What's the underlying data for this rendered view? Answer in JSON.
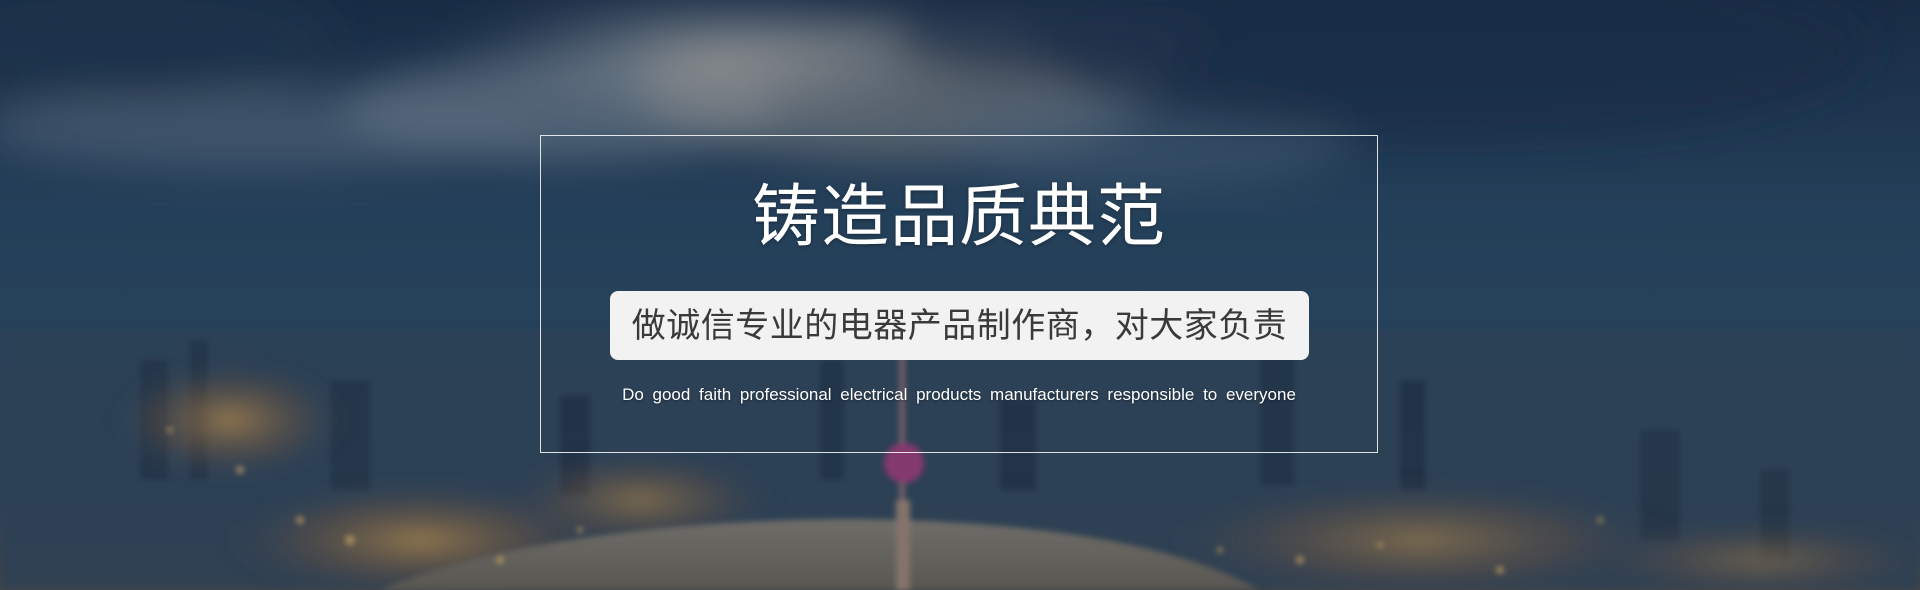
{
  "banner": {
    "headline": "铸造品质典范",
    "slogan_cn": "做诚信专业的电器产品制作商，对大家负责",
    "slogan_en": "Do good faith professional electrical products manufacturers responsible to everyone"
  },
  "colors": {
    "sky_top": "#1e3550",
    "sky_mid": "#2c4c66",
    "city_glow": "#d9a24a",
    "frame_border": "#ffffff",
    "pill_bg": "#f2f2f2",
    "pill_text": "#3a3a3a"
  }
}
